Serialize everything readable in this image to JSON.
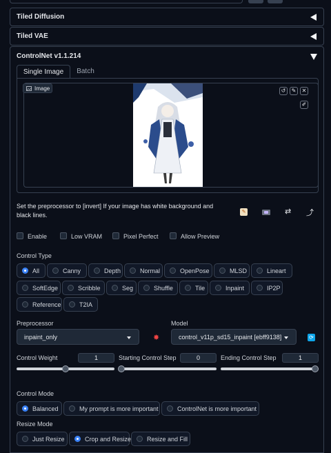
{
  "accordions": {
    "tiled_diffusion": "Tiled Diffusion",
    "tiled_vae": "Tiled VAE",
    "controlnet": "ControlNet v1.1.214"
  },
  "tabs": [
    "Single Image",
    "Batch"
  ],
  "image_panel": {
    "label": "Image"
  },
  "hint_text": "Set the preprocessor to [invert] If your image has white background and black lines.",
  "checkboxes": [
    "Enable",
    "Low VRAM",
    "Pixel Perfect",
    "Allow Preview"
  ],
  "control_type": {
    "label": "Control Type",
    "options": [
      "All",
      "Canny",
      "Depth",
      "Normal",
      "OpenPose",
      "MLSD",
      "Lineart",
      "SoftEdge",
      "Scribble",
      "Seg",
      "Shuffle",
      "Tile",
      "Inpaint",
      "IP2P",
      "Reference",
      "T2IA"
    ],
    "selected": "All"
  },
  "preprocessor": {
    "label": "Preprocessor",
    "value": "inpaint_only"
  },
  "model": {
    "label": "Model",
    "value": "control_v11p_sd15_inpaint [ebff9138]"
  },
  "sliders": {
    "control_weight": {
      "label": "Control Weight",
      "value": "1"
    },
    "start_step": {
      "label": "Starting Control Step",
      "value": "0"
    },
    "end_step": {
      "label": "Ending Control Step",
      "value": "1"
    }
  },
  "control_mode": {
    "label": "Control Mode",
    "options": [
      "Balanced",
      "My prompt is more important",
      "ControlNet is more important"
    ],
    "selected": "Balanced"
  },
  "resize_mode": {
    "label": "Resize Mode",
    "options": [
      "Just Resize",
      "Crop and Resize",
      "Resize and Fill"
    ],
    "selected": "Crop and Resize"
  },
  "icons": [
    "image-icon",
    "undo-icon",
    "edit-icon",
    "close-icon",
    "sketch-icon",
    "explosion-icon",
    "refresh-icon",
    "camera-icon",
    "webcam-icon",
    "swap-icon",
    "send-icon"
  ]
}
